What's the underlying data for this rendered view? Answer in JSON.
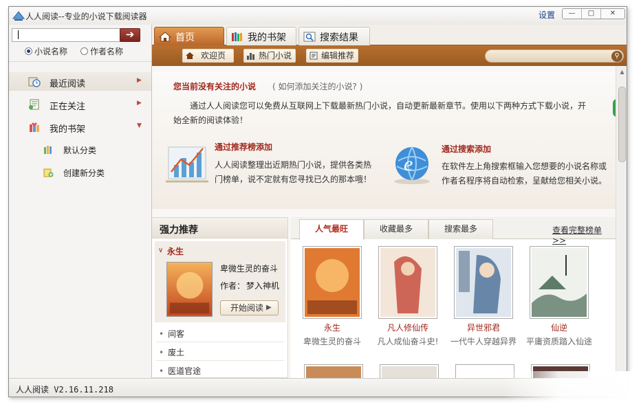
{
  "window": {
    "title": "人人阅读--专业的小说下载阅读器",
    "settings_label": "设置",
    "minimize": "—",
    "maximize": "□",
    "close": "✕"
  },
  "search": {
    "value": "",
    "go_icon": "right-arrow-icon",
    "radio": [
      {
        "label": "小说名称",
        "checked": true
      },
      {
        "label": "作者名称",
        "checked": false
      }
    ]
  },
  "sidebar": {
    "items": [
      {
        "label": "最近阅读",
        "icon": "clock-icon",
        "arrow": "▶"
      },
      {
        "label": "正在关注",
        "icon": "document-icon",
        "arrow": "▶"
      },
      {
        "label": "我的书架",
        "icon": "heart-books-icon",
        "arrow": "▼"
      }
    ],
    "subitems": [
      {
        "label": "默认分类",
        "icon": "books-icon"
      },
      {
        "label": "创建新分类",
        "icon": "new-folder-icon"
      }
    ]
  },
  "main_tabs": [
    {
      "label": "首页",
      "icon": "home-icon",
      "active": true
    },
    {
      "label": "我的书架",
      "icon": "bookshelf-icon",
      "active": false
    },
    {
      "label": "搜索结果",
      "icon": "search-results-icon",
      "active": false
    }
  ],
  "sub_nav": [
    {
      "label": "欢迎页",
      "icon": "home-icon"
    },
    {
      "label": "热门小说",
      "icon": "bars-icon"
    },
    {
      "label": "编辑推荐",
      "icon": "book-icon"
    }
  ],
  "welcome": {
    "title": "您当前没有关注的小说",
    "howto": "( 如何添加关注的小说? )",
    "intro": "通过人人阅读您可以免费从互联网上下载最新热门小说，自动更新最新章节。使用以下两种方式下载小说，开始全新的阅读体验！",
    "method1_title": "通过推荐榜添加",
    "method1_text": "人人阅读整理出近期热门小说，提供各类热门榜单，说不定就有您寻找已久的那本哦！",
    "method2_title": "通过搜索添加",
    "method2_text": "在软件左上角搜索框输入您想要的小说名称或作者名程序将自动检索，呈献给您相关小说。"
  },
  "recommend": {
    "header": "强力推荐",
    "featured": {
      "title": "永生",
      "desc": "卑微生灵的奋斗",
      "author_label": "作者：",
      "author": "梦入神机",
      "start_button": "开始阅读"
    },
    "list": [
      "间客",
      "废土",
      "医道官途"
    ]
  },
  "ranking": {
    "tabs": [
      "人气最旺",
      "收藏最多",
      "搜索最多"
    ],
    "active_tab": 0,
    "more_link": "查看完整榜单>>",
    "books": [
      {
        "title": "永生",
        "desc": "卑微生灵的奋斗",
        "cover_color": "#d86a2c"
      },
      {
        "title": "凡人修仙传",
        "desc": "凡人成仙奋斗史!",
        "cover_color": "#b0352a"
      },
      {
        "title": "异世邪君",
        "desc": "一代牛人穿越异界",
        "cover_color": "#3d5a7a"
      },
      {
        "title": "仙逆",
        "desc": "平庸资质踏入仙途",
        "cover_color": "#4a6a55"
      }
    ]
  },
  "status": {
    "text": "人人阅读 V2.16.11.218"
  }
}
